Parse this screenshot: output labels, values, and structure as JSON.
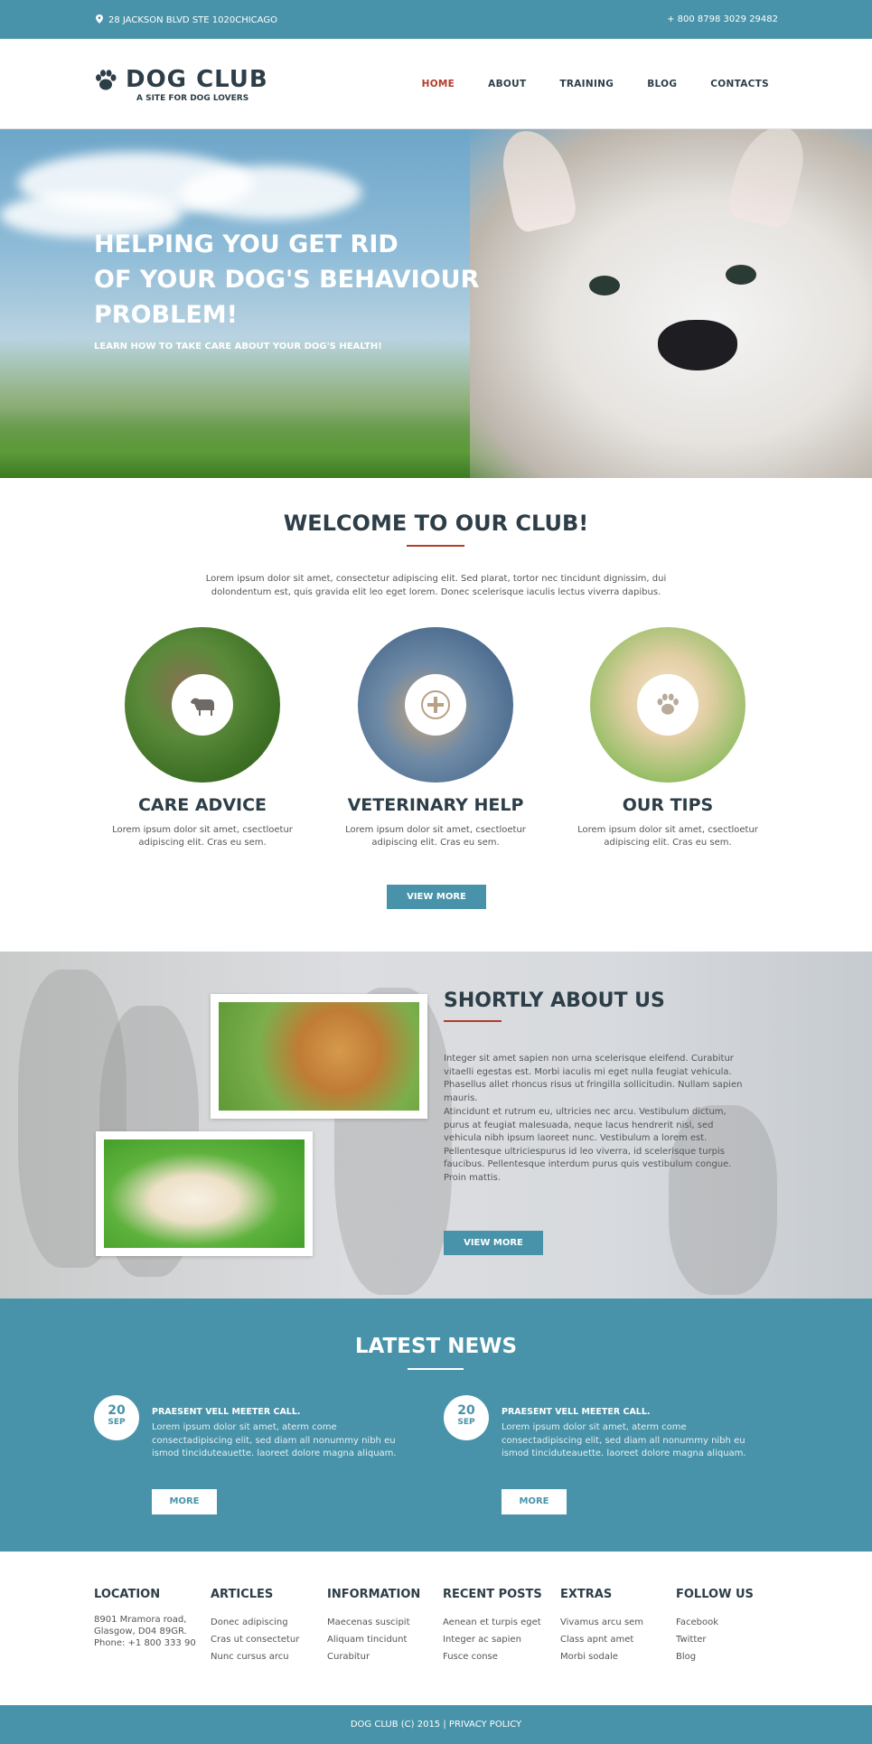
{
  "topbar": {
    "address": "28 JACKSON BLVD STE 1020CHICAGO",
    "phone": "+ 800 8798 3029 29482"
  },
  "logo": {
    "title": "DOG CLUB",
    "tagline": "A SITE FOR DOG LOVERS"
  },
  "nav": {
    "items": [
      {
        "label": "HOME",
        "active": true
      },
      {
        "label": "ABOUT",
        "active": false
      },
      {
        "label": "TRAINING",
        "active": false
      },
      {
        "label": "BLOG",
        "active": false
      },
      {
        "label": "CONTACTS",
        "active": false
      }
    ]
  },
  "hero": {
    "line1": "HELPING YOU GET RID",
    "line2": "OF YOUR DOG'S BEHAVIOUR",
    "line3": "PROBLEM!",
    "subtitle": "LEARN HOW TO TAKE CARE ABOUT YOUR DOG'S HEALTH!"
  },
  "welcome": {
    "title": "WELCOME TO OUR CLUB!",
    "text": "Lorem ipsum dolor sit amet, consectetur adipiscing elit. Sed plarat, tortor nec tincidunt dignissim, dui dolondentum est, quis gravida elit leo eget lorem. Donec scelerisque iaculis lectus viverra dapibus.",
    "features": [
      {
        "title": "CARE ADVICE",
        "text": "Lorem ipsum dolor sit amet, csectloetur adipiscing elit. Cras eu sem.",
        "icon": "dog-icon"
      },
      {
        "title": "VETERINARY HELP",
        "text": "Lorem ipsum dolor sit amet, csectloetur adipiscing elit. Cras eu sem.",
        "icon": "plus-icon"
      },
      {
        "title": "OUR TIPS",
        "text": "Lorem ipsum dolor sit amet, csectloetur adipiscing elit. Cras eu sem.",
        "icon": "paw-icon"
      }
    ],
    "button": "VIEW MORE"
  },
  "about": {
    "title": "SHORTLY ABOUT US",
    "para1": "Integer sit amet sapien non urna scelerisque eleifend. Curabitur vitaelli egestas est. Morbi iaculis mi eget nulla feugiat vehicula. Phasellus allet rhoncus risus ut fringilla sollicitudin. Nullam sapien mauris.",
    "para2": "Atincidunt et rutrum eu, ultricies nec arcu. Vestibulum dictum, purus at feugiat malesuada, neque lacus hendrerit nisl, sed vehicula nibh ipsum laoreet nunc. Vestibulum a lorem est. Pellentesque ultriciespurus id leo viverra, id scelerisque turpis faucibus. Pellentesque interdum purus quis vestibulum congue. Proin mattis.",
    "button": "VIEW MORE"
  },
  "news": {
    "title": "LATEST NEWS",
    "items": [
      {
        "day": "20",
        "month": "SEP",
        "heading": "PRAESENT VELL MEETER CALL.",
        "text": "Lorem ipsum dolor sit amet, aterm come consectadipiscing elit, sed diam all nonummy nibh eu ismod tinciduteauette. laoreet dolore magna aliquam.",
        "button": "MORE"
      },
      {
        "day": "20",
        "month": "SEP",
        "heading": "PRAESENT VELL MEETER CALL.",
        "text": "Lorem ipsum dolor sit amet, aterm come consectadipiscing elit, sed diam all nonummy nibh eu ismod tinciduteauette. laoreet dolore magna aliquam.",
        "button": "MORE"
      }
    ]
  },
  "footer": {
    "location": {
      "title": "LOCATION",
      "line1": "8901 Mramora road,",
      "line2": "Glasgow, D04 89GR.",
      "line3": "Phone: +1 800 333 90"
    },
    "columns": [
      {
        "title": "ARTICLES",
        "links": [
          "Donec adipiscing",
          "Cras ut consectetur",
          "Nunc cursus arcu"
        ]
      },
      {
        "title": "INFORMATION",
        "links": [
          "Maecenas suscipit",
          "Aliquam tincidunt",
          "Curabitur"
        ]
      },
      {
        "title": "RECENT POSTS",
        "links": [
          "Aenean et turpis eget",
          "Integer ac sapien",
          "Fusce conse"
        ]
      },
      {
        "title": "EXTRAS",
        "links": [
          "Vivamus arcu sem",
          "Class apnt amet",
          "Morbi sodale"
        ]
      },
      {
        "title": "FOLLOW US",
        "links": [
          "Facebook",
          "Twitter",
          "Blog"
        ]
      }
    ],
    "copyright": "DOG CLUB (C) 2015",
    "separator": "|",
    "privacy": "PRIVACY POLICY"
  },
  "colors": {
    "accent": "#4893a9",
    "active_nav": "#b53a2a",
    "heading": "#2d3e48"
  }
}
